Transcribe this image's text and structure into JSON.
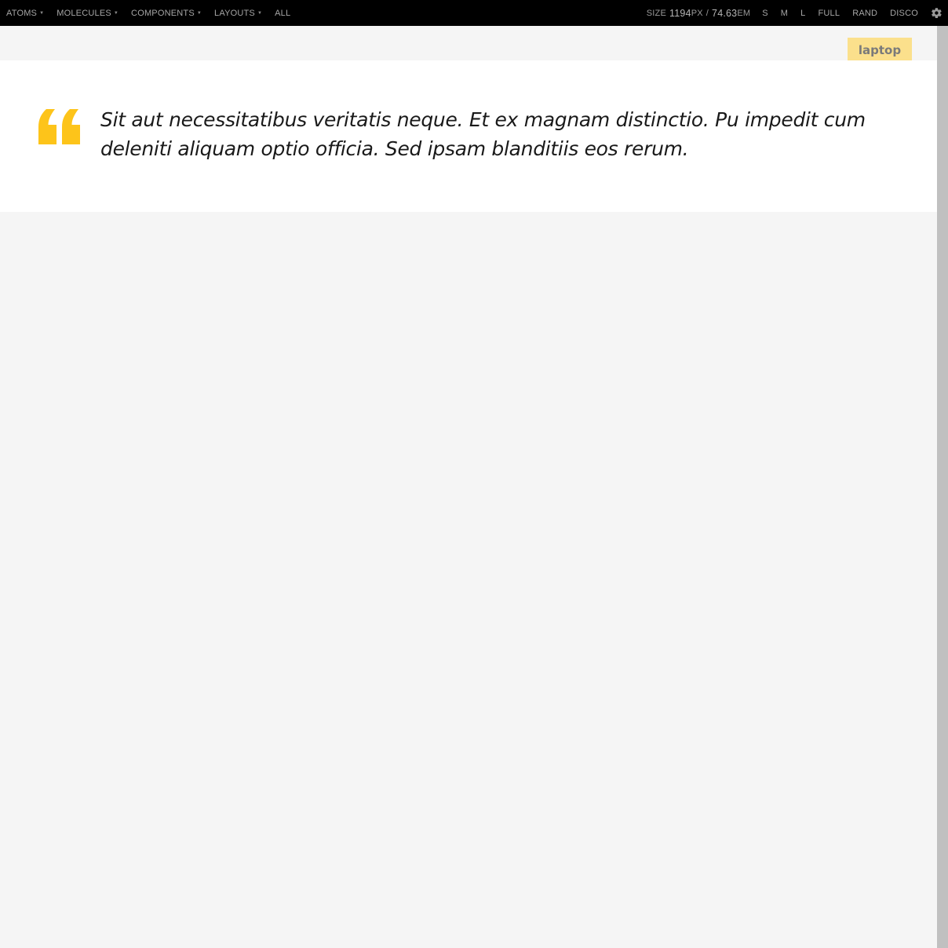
{
  "toolbar": {
    "nav": [
      {
        "label": "ATOMS",
        "has_menu": true
      },
      {
        "label": "MOLECULES",
        "has_menu": true
      },
      {
        "label": "COMPONENTS",
        "has_menu": true
      },
      {
        "label": "LAYOUTS",
        "has_menu": true
      },
      {
        "label": "ALL",
        "has_menu": false
      }
    ],
    "size": {
      "label": "SIZE",
      "px_value": "1194",
      "px_unit": "PX",
      "separator": "/",
      "em_value": "74.63",
      "em_unit": "EM"
    },
    "controls": [
      "S",
      "M",
      "L",
      "FULL",
      "RAND",
      "DISCO"
    ],
    "settings_icon": "gear-icon"
  },
  "viewport": {
    "breakpoint_label": "laptop",
    "quote": {
      "icon": "quote-mark-icon",
      "text": "Sit aut necessitatibus veritatis neque. Et ex magnam distinctio. Pu impedit cum deleniti aliquam optio officia. Sed ipsam blanditiis eos rerum."
    }
  },
  "colors": {
    "toolbar_bg": "#000000",
    "toolbar_text": "#a6a6a6",
    "accent_yellow": "#fdc41a",
    "tag_bg": "#fbe08c",
    "page_bg": "#f5f5f5",
    "handle": "#c0c0c0"
  }
}
